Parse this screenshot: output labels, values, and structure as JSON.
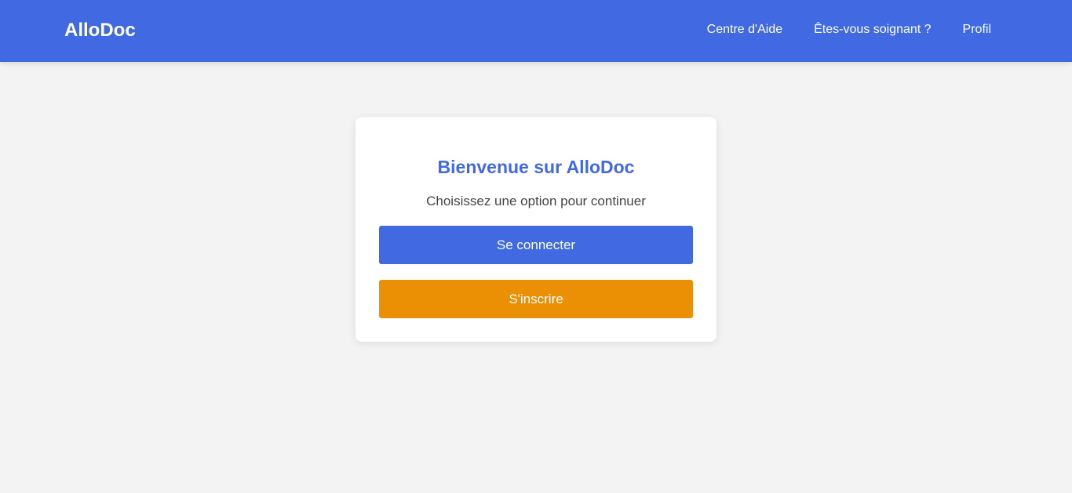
{
  "navbar": {
    "brand": "AlloDoc",
    "links": [
      {
        "label": "Centre d'Aide"
      },
      {
        "label": "Êtes-vous soignant ?"
      },
      {
        "label": "Profil"
      }
    ],
    "background": "#4169e1"
  },
  "welcome_card": {
    "title": "Bienvenue sur AlloDoc",
    "subtitle": "Choisissez une option pour continuer",
    "login_button": {
      "label": "Se connecter",
      "color": "#4169e1"
    },
    "signup_button": {
      "label": "S'inscrire",
      "color": "#eb8f05"
    }
  }
}
